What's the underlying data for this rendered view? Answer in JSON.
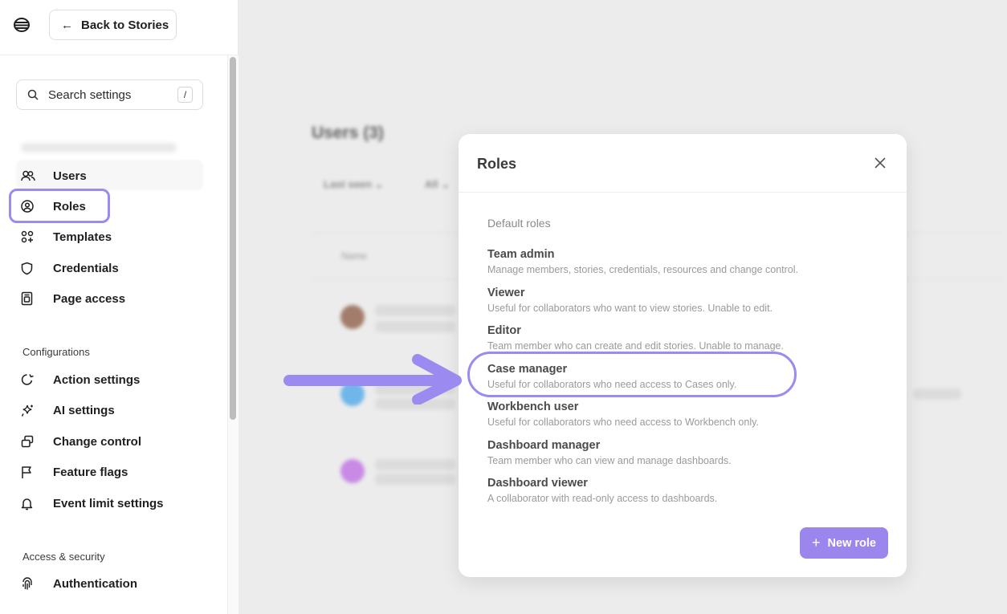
{
  "topbar": {
    "back_label": "Back to Stories"
  },
  "search": {
    "placeholder": "Search settings",
    "shortcut": "/"
  },
  "sidebar": {
    "primary": [
      {
        "label": "Users",
        "icon": "users-icon"
      },
      {
        "label": "Roles",
        "icon": "user-circle-icon"
      },
      {
        "label": "Templates",
        "icon": "templates-icon"
      },
      {
        "label": "Credentials",
        "icon": "shield-icon"
      },
      {
        "label": "Page access",
        "icon": "page-access-icon"
      }
    ],
    "configurations_title": "Configurations",
    "configurations": [
      {
        "label": "Action settings",
        "icon": "action-settings-icon"
      },
      {
        "label": "AI settings",
        "icon": "sparkle-icon"
      },
      {
        "label": "Change control",
        "icon": "change-control-icon"
      },
      {
        "label": "Feature flags",
        "icon": "flag-icon"
      },
      {
        "label": "Event limit settings",
        "icon": "bell-icon"
      }
    ],
    "access_title": "Access & security",
    "access": [
      {
        "label": "Authentication",
        "icon": "fingerprint-icon"
      }
    ]
  },
  "background": {
    "title": "Users (3)",
    "filter_1": "Last seen",
    "filter_2": "All",
    "col_name": "Name"
  },
  "modal": {
    "title": "Roles",
    "section": "Default roles",
    "roles": [
      {
        "name": "Team admin",
        "desc": "Manage members, stories, credentials, resources and change control."
      },
      {
        "name": "Viewer",
        "desc": "Useful for collaborators who want to view stories. Unable to edit."
      },
      {
        "name": "Editor",
        "desc": "Team member who can create and edit stories. Unable to manage."
      },
      {
        "name": "Case manager",
        "desc": "Useful for collaborators who need access to Cases only."
      },
      {
        "name": "Workbench user",
        "desc": "Useful for collaborators who need access to Workbench only."
      },
      {
        "name": "Dashboard manager",
        "desc": "Team member who can view and manage dashboards."
      },
      {
        "name": "Dashboard viewer",
        "desc": "A collaborator with read-only access to dashboards."
      }
    ],
    "new_role_label": "New role"
  },
  "colors": {
    "accent": "#9b86ee",
    "highlight": "#9b8af0"
  }
}
